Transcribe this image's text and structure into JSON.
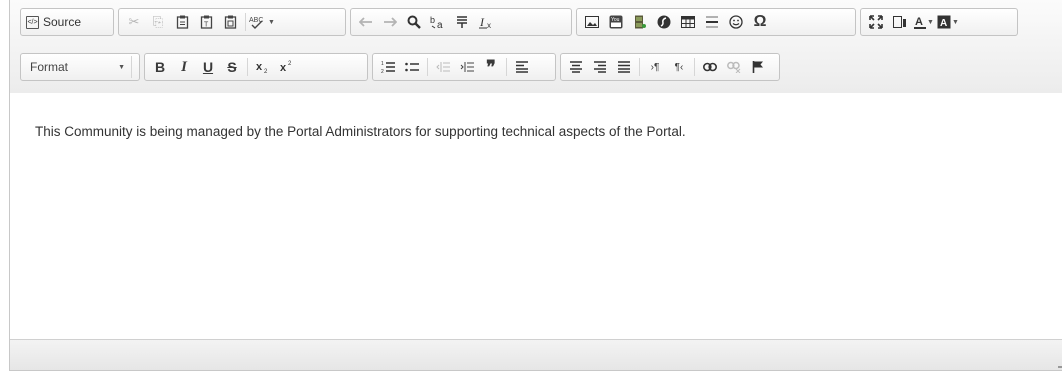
{
  "toolbar": {
    "source_label": "Source",
    "format_label": "Format"
  },
  "content": {
    "text": "This Community is being managed by the Portal Administrators for supporting technical aspects of the Portal."
  },
  "colors": {
    "toolbar_bg": "#f2f2f2",
    "text": "#333333",
    "border": "#c4c4c4"
  }
}
